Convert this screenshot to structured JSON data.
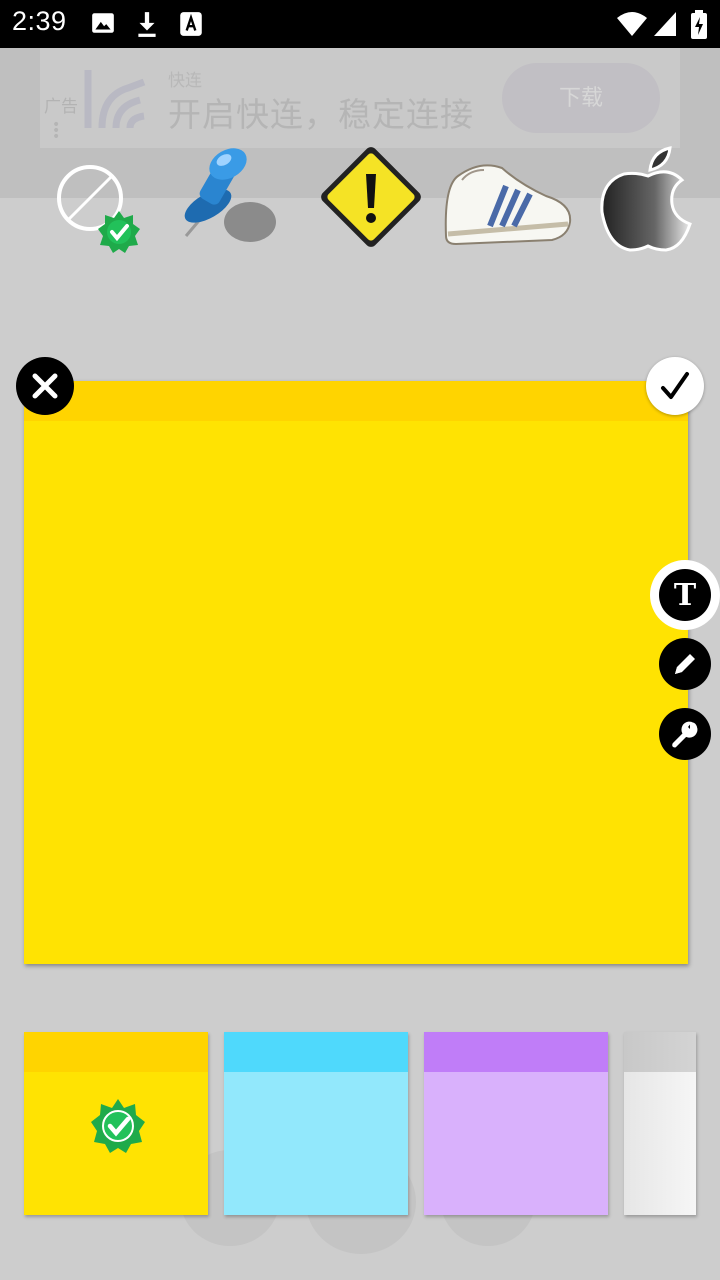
{
  "status_bar": {
    "time": "2:39",
    "icons": [
      "image-icon",
      "download-icon",
      "accessibility-icon",
      "wifi-icon",
      "signal-icon",
      "battery-charging-icon"
    ]
  },
  "ad": {
    "tag": "广告",
    "brand": "快连",
    "headline": "开启快连，稳定连接",
    "button_label": "下载"
  },
  "stickers": [
    {
      "name": "no-sticker-icon",
      "selected": true
    },
    {
      "name": "pushpin-icon"
    },
    {
      "name": "warning-sign-icon"
    },
    {
      "name": "sneaker-icon"
    },
    {
      "name": "apple-logo-icon"
    }
  ],
  "note": {
    "top_color": "#ffd400",
    "body_color": "#ffe302"
  },
  "tools": {
    "text_label": "T"
  },
  "swatches": [
    {
      "top": "#ffd400",
      "body": "#ffe302",
      "selected": true
    },
    {
      "top": "#4fd9fc",
      "body": "#92e8fc"
    },
    {
      "top": "#c07df8",
      "body": "#d9b1fc"
    },
    {
      "top": "#c8c8c8",
      "body": "#e6e6e6"
    }
  ]
}
